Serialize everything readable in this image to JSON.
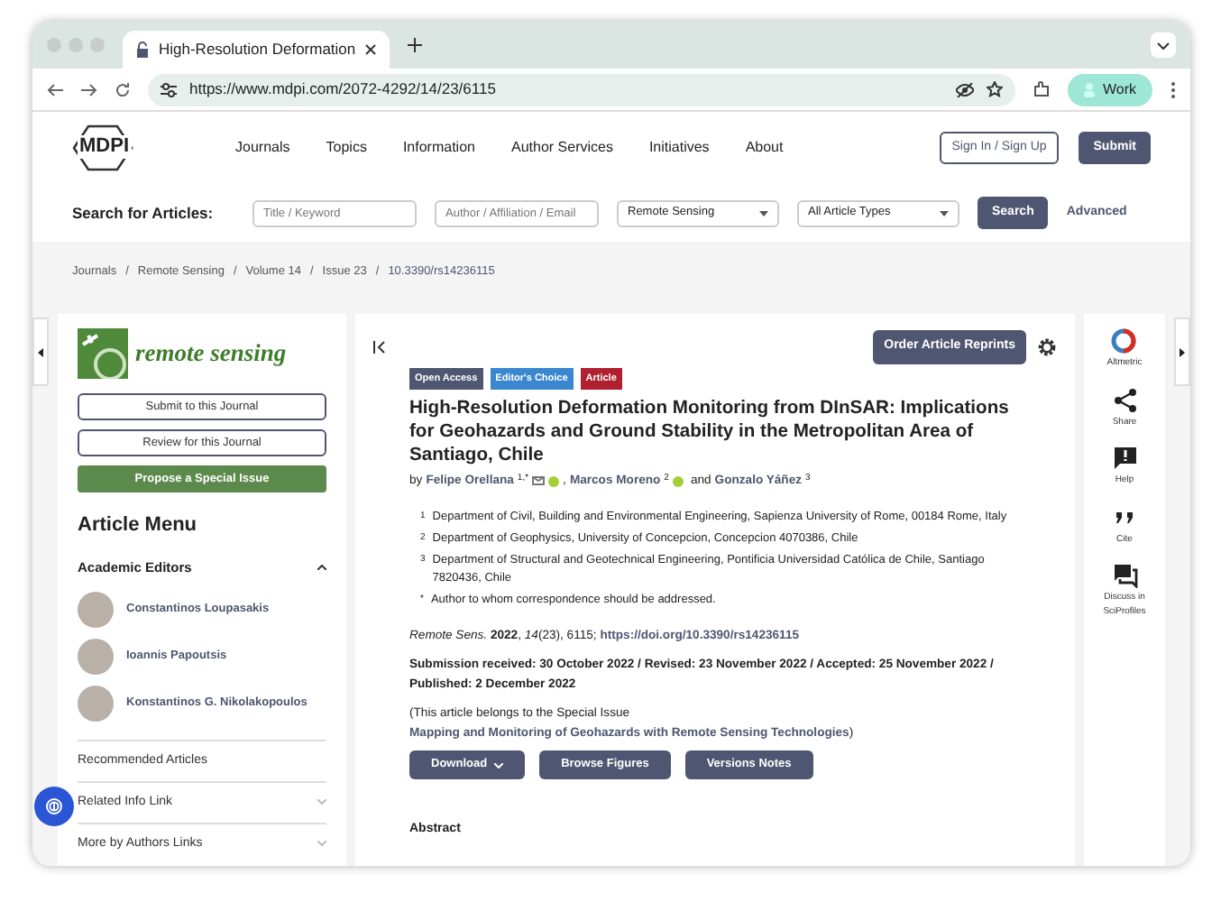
{
  "browser": {
    "tab_title": "High-Resolution Deformation",
    "url": "https://www.mdpi.com/2072-4292/14/23/6115",
    "profile": "Work"
  },
  "header": {
    "logo": "MDPI",
    "nav": [
      "Journals",
      "Topics",
      "Information",
      "Author Services",
      "Initiatives",
      "About"
    ],
    "sign_in": "Sign In / Sign Up",
    "submit": "Submit"
  },
  "search": {
    "label": "Search for Articles:",
    "fields": [
      {
        "placeholder": "Title / Keyword"
      },
      {
        "placeholder": "Author / Affiliation / Email"
      }
    ],
    "selects": [
      "Remote Sensing",
      "All Article Types"
    ],
    "button": "Search",
    "advanced": "Advanced"
  },
  "breadcrumb": {
    "items": [
      "Journals",
      "Remote Sensing",
      "Volume 14",
      "Issue 23",
      "10.3390/rs14236115"
    ],
    "separators": [
      "/",
      "/",
      "/",
      "/"
    ]
  },
  "sidebar": {
    "journal": "remote sensing",
    "buttons": [
      "Submit to this Journal",
      "Review for this Journal"
    ],
    "propose": "Propose a Special Issue",
    "menu_title": "Article Menu",
    "editors_heading": "Academic Editors",
    "expanded": true,
    "editors": [
      {
        "name": "Constantinos Loupasakis"
      },
      {
        "name": "Ioannis Papoutsis"
      },
      {
        "name": "Konstantinos G. Nikolakopoulos"
      }
    ],
    "links": [
      {
        "label": "Recommended Articles",
        "expandable": false
      },
      {
        "label": "Related Info Link",
        "expandable": true
      },
      {
        "label": "More by Authors Links",
        "expandable": true
      }
    ]
  },
  "article": {
    "reprints": "Order Article Reprints",
    "badges": [
      {
        "label": "Open Access",
        "color": "#4f5671"
      },
      {
        "label": "Editor's Choice",
        "color": "#3a86cf"
      },
      {
        "label": "Article",
        "color": "#b0202e"
      }
    ],
    "title": "High-Resolution Deformation Monitoring from DInSAR: Implications for Geohazards and Ground Stability in the Metropolitan Area of Santiago, Chile",
    "authors": [
      {
        "before": "by",
        "name": "Felipe Orellana",
        "sup": "1,*",
        "email": true,
        "orcid": true
      },
      {
        "before": ",",
        "name": "Marcos Moreno",
        "sup": "2",
        "email": false,
        "orcid": true
      },
      {
        "before": "and",
        "name": "Gonzalo Yáñez",
        "sup": "3",
        "email": false,
        "orcid": false
      }
    ],
    "affiliations": [
      {
        "mark": "1",
        "text": "Department of Civil, Building and Environmental Engineering, Sapienza University of Rome, 00184 Rome, Italy"
      },
      {
        "mark": "2",
        "text": "Department of Geophysics, University of Concepcion, Concepcion 4070386, Chile"
      },
      {
        "mark": "3",
        "text": "Department of Structural and Geotechnical Engineering, Pontificia Universidad Católica de Chile, Santiago 7820436, Chile"
      },
      {
        "mark": "*",
        "text": "Author to whom correspondence should be addressed."
      }
    ],
    "citation": "*Remote Sens.* **2022**, *14*(23), 6115;",
    "doi": "https://doi.org/10.3390/rs14236115",
    "dates": "Submission received: 30 October 2022 / Revised: 23 November 2022 / Accepted: 25 November 2022 / Published: 2 December 2022",
    "special_issue": {
      "before": "(This article belongs to the Special Issue",
      "link": "Mapping and Monitoring of Geohazards with Remote Sensing Technologies",
      "after": ")"
    },
    "actions": [
      {
        "label": "Download",
        "dropdown": true
      },
      {
        "label": "Browse Figures",
        "dropdown": false
      },
      {
        "label": "Versions Notes",
        "dropdown": false
      }
    ],
    "abstract_heading": "Abstract"
  },
  "rail": [
    {
      "kind": "altmetric",
      "label": "Altmetric"
    },
    {
      "kind": "share",
      "label": "Share"
    },
    {
      "kind": "help",
      "label": "Help"
    },
    {
      "kind": "cite",
      "label": "Cite"
    },
    {
      "kind": "discuss",
      "label": "Discuss in SciProfiles"
    }
  ]
}
